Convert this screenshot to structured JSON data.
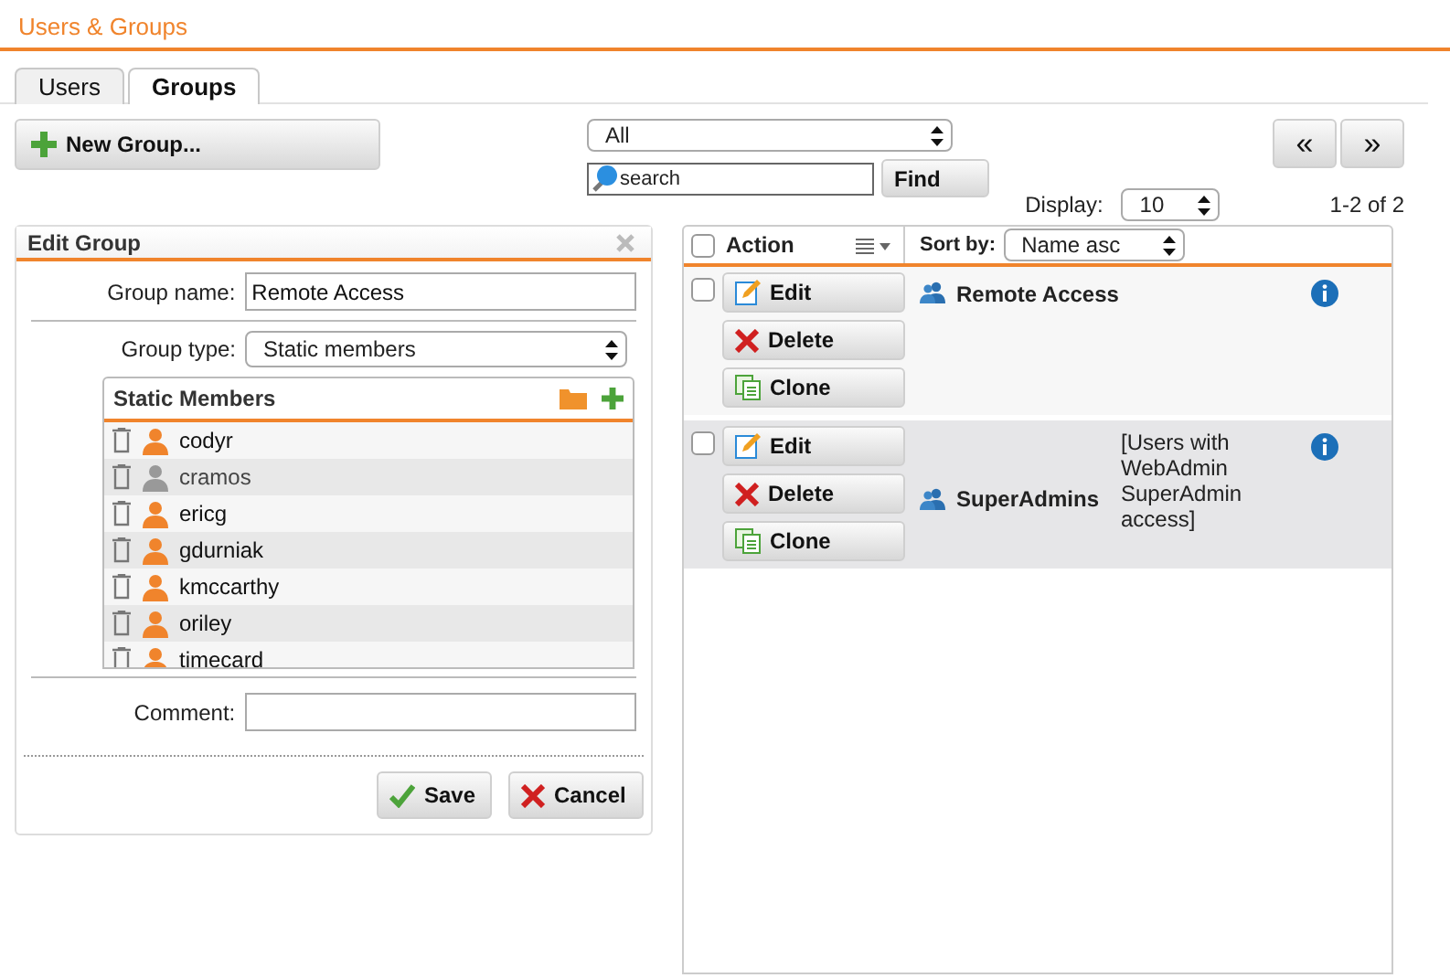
{
  "page_title": "Users & Groups",
  "tabs": [
    {
      "label": "Users",
      "selected": false
    },
    {
      "label": "Groups",
      "selected": true
    }
  ],
  "new_button": "New Group...",
  "filter": {
    "value": "All"
  },
  "search": {
    "placeholder": "search",
    "button": "Find"
  },
  "pager": {
    "prev": "«",
    "next": "»",
    "display_label": "Display:",
    "display_value": "10",
    "range": "1-2 of 2"
  },
  "edit_panel": {
    "title": "Edit Group",
    "name_label": "Group name:",
    "name_value": "Remote Access",
    "type_label": "Group type:",
    "type_value": "Static members",
    "members_title": "Static Members",
    "members": [
      {
        "name": "codyr",
        "enabled": true
      },
      {
        "name": "cramos",
        "enabled": false
      },
      {
        "name": "ericg",
        "enabled": true
      },
      {
        "name": "gdurniak",
        "enabled": true
      },
      {
        "name": "kmccarthy",
        "enabled": true
      },
      {
        "name": "oriley",
        "enabled": true
      },
      {
        "name": "timecard",
        "enabled": true
      }
    ],
    "comment_label": "Comment:",
    "save": "Save",
    "cancel": "Cancel"
  },
  "table": {
    "action_header": "Action",
    "sort_label": "Sort by:",
    "sort_value": "Name asc",
    "all_checked": false,
    "rows": [
      {
        "checked": false,
        "name": "Remote Access",
        "buttons": [
          "Edit",
          "Delete",
          "Clone"
        ]
      },
      {
        "checked": false,
        "name": "SuperAdmins",
        "description": "[Users with WebAdmin SuperAdmin access]",
        "buttons": [
          "Edit",
          "Delete",
          "Clone"
        ]
      }
    ]
  }
}
